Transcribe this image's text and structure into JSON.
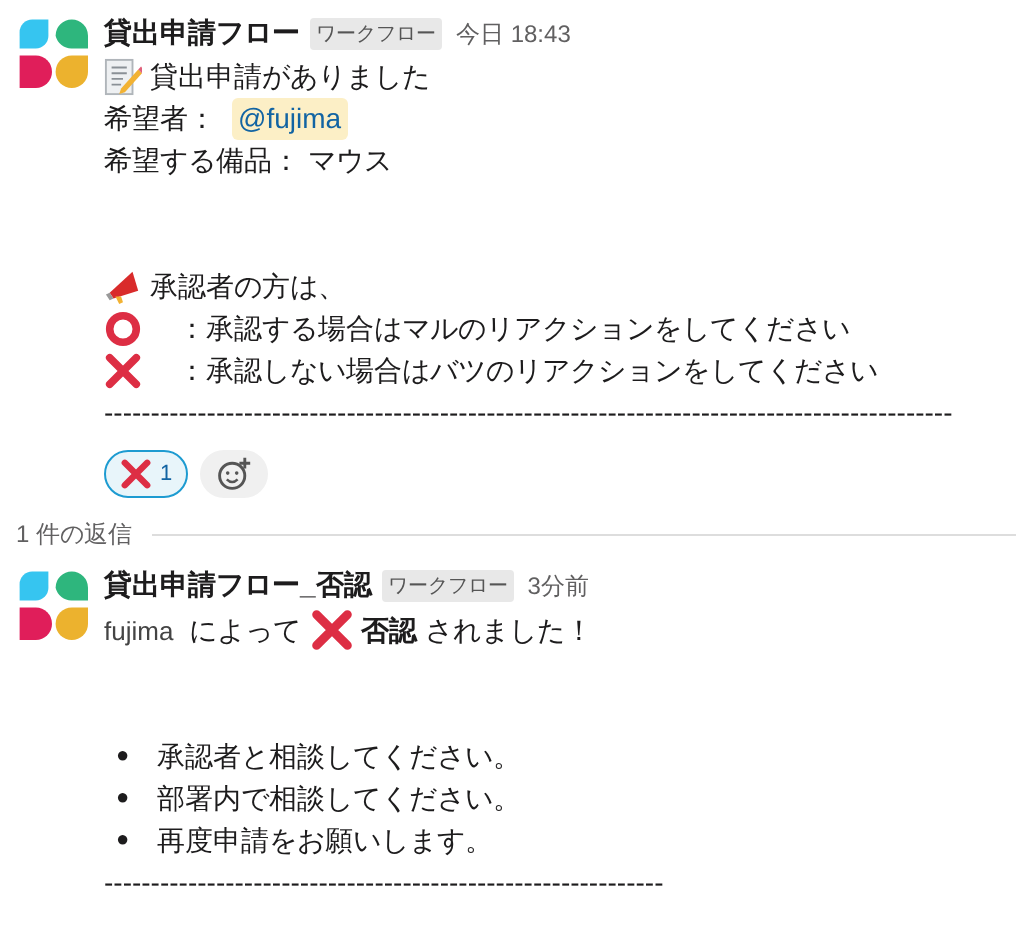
{
  "messages": [
    {
      "sender": "貸出申請フロー",
      "badge": "ワークフロー",
      "time": "今日 18:43",
      "lines": [
        {
          "kind": "memo",
          "text": "貸出申請がありました"
        },
        {
          "kind": "mention",
          "label": "希望者：",
          "mention": "@fujima"
        },
        {
          "kind": "text",
          "text": "希望する備品： マウス"
        },
        {
          "kind": "spacer"
        },
        {
          "kind": "spacer"
        },
        {
          "kind": "megaphone",
          "text": "承認者の方は、"
        },
        {
          "kind": "circle",
          "text": "：承認する場合はマルのリアクションをしてください"
        },
        {
          "kind": "cross",
          "text": "：承認しない場合はバツのリアクションをしてください"
        },
        {
          "kind": "text",
          "text": "-------------------------------------------------------------------------------------------"
        }
      ],
      "reactions": [
        {
          "count": "1",
          "selected": true
        }
      ],
      "replies": "1 件の返信"
    },
    {
      "sender": "貸出申請フロー_否認",
      "badge": "ワークフロー",
      "time": "3分前",
      "lines": [
        {
          "kind": "verdict",
          "user": "fujima",
          "before": "によって",
          "word": "否認",
          "after": "されました！"
        },
        {
          "kind": "spacer"
        },
        {
          "kind": "spacer"
        },
        {
          "kind": "bullet",
          "mark": "●",
          "text": "承認者と相談してください。"
        },
        {
          "kind": "bullet",
          "mark": "●",
          "text": "部署内で相談してください。"
        },
        {
          "kind": "bullet",
          "mark": "●",
          "text": "再度申請をお願いします。"
        },
        {
          "kind": "text",
          "text": "------------------------------------------------------------"
        }
      ]
    }
  ]
}
